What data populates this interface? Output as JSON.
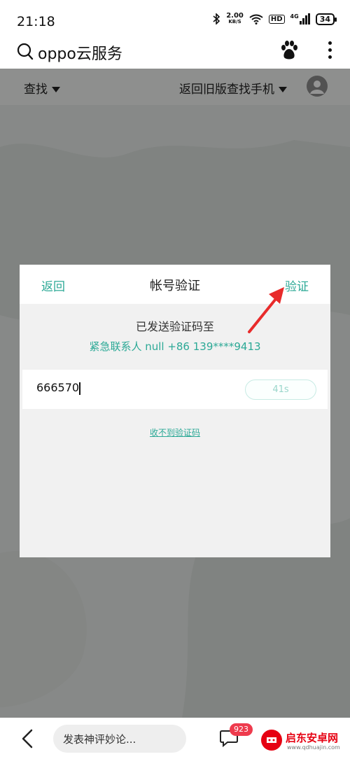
{
  "status": {
    "time": "21:18",
    "net_speed": "2.00",
    "net_unit": "KB/S",
    "hd": "HD",
    "signal": "4G",
    "battery": "34"
  },
  "header": {
    "search_text": "oppo云服务"
  },
  "topnav": {
    "find": "查找",
    "old_version": "返回旧版查找手机"
  },
  "dialog": {
    "back": "返回",
    "title": "帐号验证",
    "verify": "验证",
    "sent_message": "已发送验证码至",
    "contact": "紧急联系人 null +86 139****9413",
    "code_value": "666570",
    "countdown": "41s",
    "no_code_link": "收不到验证码"
  },
  "bottom": {
    "comment_placeholder": "发表神评妙论...",
    "comment_count": "923",
    "brand_name": "启东安卓网",
    "brand_url": "www.qdhuajin.com"
  },
  "colors": {
    "accent": "#2ca996",
    "badge": "#ee3b4d",
    "arrow": "#e82b2b"
  }
}
